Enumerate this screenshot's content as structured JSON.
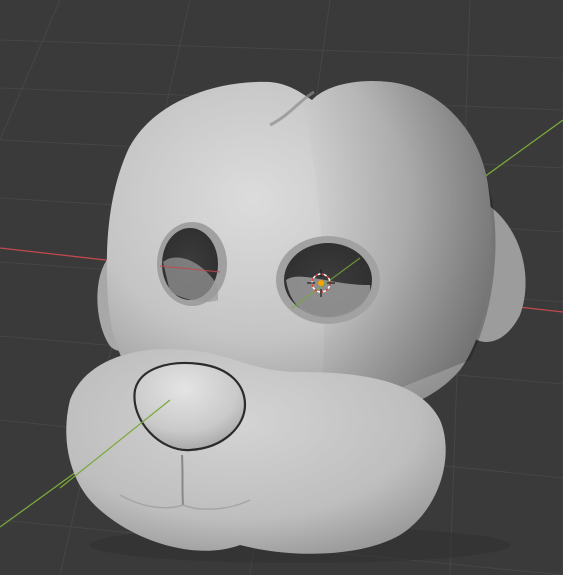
{
  "viewport": {
    "background": "#3a3a3a",
    "grid_color": "#464646",
    "x_axis_color": "#c0494f",
    "y_axis_color": "#7aa83a",
    "mesh_color": "#c4c4c4",
    "object_origin_color": "#f5a300"
  },
  "objects": [
    {
      "name": "dog-head-mesh",
      "kind": "sculpt mesh"
    },
    {
      "name": "3d-cursor",
      "kind": "cursor"
    }
  ]
}
